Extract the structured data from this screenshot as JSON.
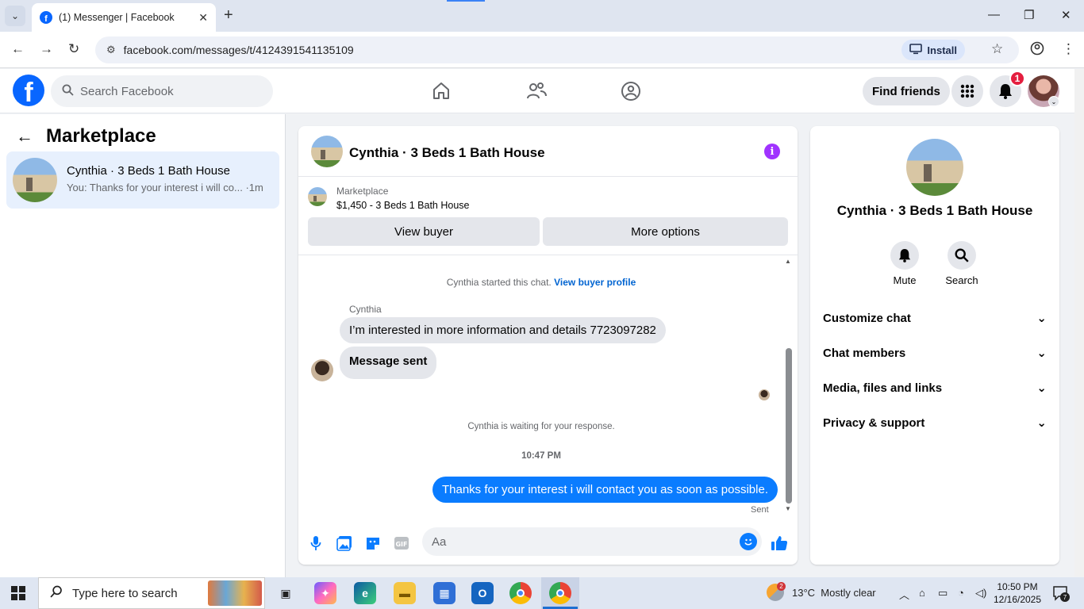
{
  "browser": {
    "tab_title": "(1) Messenger | Facebook",
    "url": "facebook.com/messages/t/4124391541135109",
    "install_label": "Install"
  },
  "fb_header": {
    "search_placeholder": "Search Facebook",
    "find_friends_label": "Find friends",
    "notification_count": "1"
  },
  "sidebar": {
    "title": "Marketplace",
    "conversations": [
      {
        "name": "Cynthia · 3 Beds 1 Bath House",
        "preview": "You: Thanks for your interest i will co...",
        "time": "·1m"
      }
    ]
  },
  "chat": {
    "title": "Cynthia · 3 Beds 1 Bath House",
    "marketplace_label": "Marketplace",
    "listing": "$1,450 - 3 Beds 1 Bath House",
    "view_buyer_label": "View buyer",
    "more_options_label": "More options",
    "started_text": "Cynthia started this chat.",
    "view_buyer_profile_link": "View buyer profile",
    "sender_name": "Cynthia",
    "incoming_messages": [
      "I’m interested in more information and details 7723097282",
      "Message sent"
    ],
    "waiting_text": "Cynthia is waiting for your response.",
    "timestamp": "10:47 PM",
    "outgoing_message": "Thanks for your interest i will contact you as soon as possible.",
    "sent_status": "Sent",
    "composer_placeholder": "Aa"
  },
  "right_panel": {
    "title": "Cynthia · 3 Beds 1 Bath House",
    "mute_label": "Mute",
    "search_label": "Search",
    "sections": [
      "Customize chat",
      "Chat members",
      "Media, files and links",
      "Privacy & support"
    ]
  },
  "taskbar": {
    "search_placeholder": "Type here to search",
    "weather_badge": "2",
    "temperature": "13°C",
    "weather": "Mostly clear",
    "time": "10:50 PM",
    "date": "12/16/2025",
    "notification_count": "7"
  },
  "colors": {
    "fb_blue": "#0866ff",
    "messenger_blue": "#0a7cff",
    "info_purple": "#a033ff",
    "badge_red": "#e41e3f"
  }
}
